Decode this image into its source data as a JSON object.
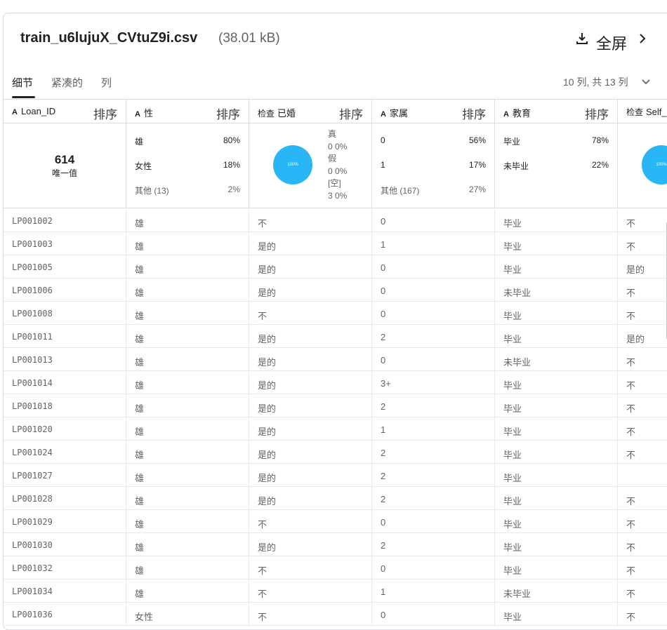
{
  "header": {
    "filename": "train_u6lujuX_CVtuZ9i.csv",
    "filesize": "(38.01 kB)",
    "fullscreen_label": "全屏"
  },
  "tabs": [
    {
      "label": "细节",
      "active": true
    },
    {
      "label": "紧凑的",
      "active": false
    },
    {
      "label": "列",
      "active": false
    }
  ],
  "column_count": "10 列, 共 13 列",
  "columns": [
    {
      "name": "Loan_ID",
      "type_icon": "A",
      "sort": "排序"
    },
    {
      "name": "性",
      "type_icon": "A",
      "sort": "排序"
    },
    {
      "name": "已婚",
      "type_icon": "检查",
      "sort": "排序"
    },
    {
      "name": "家属",
      "type_icon": "A",
      "sort": "排序"
    },
    {
      "name": "教育",
      "type_icon": "A",
      "sort": "排序"
    },
    {
      "name": "Self_",
      "type_icon": "检查",
      "sort": ""
    }
  ],
  "summary": {
    "loan_id": {
      "unique_count": "614",
      "unique_label": "唯一值"
    },
    "gender": [
      {
        "label": "雄",
        "pct": "80%"
      },
      {
        "label": "女性",
        "pct": "18%"
      },
      {
        "label": "其他 (13)",
        "pct": "2%"
      }
    ],
    "married": {
      "pie_label": "100%",
      "legend": [
        "真",
        "0  0%",
        "假",
        "0  0%",
        "[空]",
        "3  0%"
      ]
    },
    "dependents": [
      {
        "label": "0",
        "pct": "56%"
      },
      {
        "label": "1",
        "pct": "17%"
      },
      {
        "label": "其他 (167)",
        "pct": "27%"
      }
    ],
    "education": [
      {
        "label": "毕业",
        "pct": "78%"
      },
      {
        "label": "未毕业",
        "pct": "22%"
      }
    ],
    "self_employed": {
      "pie_label": "100%"
    }
  },
  "rows": [
    [
      "LP001002",
      "雄",
      "不",
      "0",
      "毕业",
      "不"
    ],
    [
      "LP001003",
      "雄",
      "是的",
      "1",
      "毕业",
      "不"
    ],
    [
      "LP001005",
      "雄",
      "是的",
      "0",
      "毕业",
      "是的"
    ],
    [
      "LP001006",
      "雄",
      "是的",
      "0",
      "未毕业",
      "不"
    ],
    [
      "LP001008",
      "雄",
      "不",
      "0",
      "毕业",
      "不"
    ],
    [
      "LP001011",
      "雄",
      "是的",
      "2",
      "毕业",
      "是的"
    ],
    [
      "LP001013",
      "雄",
      "是的",
      "0",
      "未毕业",
      "不"
    ],
    [
      "LP001014",
      "雄",
      "是的",
      "3+",
      "毕业",
      "不"
    ],
    [
      "LP001018",
      "雄",
      "是的",
      "2",
      "毕业",
      "不"
    ],
    [
      "LP001020",
      "雄",
      "是的",
      "1",
      "毕业",
      "不"
    ],
    [
      "LP001024",
      "雄",
      "是的",
      "2",
      "毕业",
      "不"
    ],
    [
      "LP001027",
      "雄",
      "是的",
      "2",
      "毕业",
      ""
    ],
    [
      "LP001028",
      "雄",
      "是的",
      "2",
      "毕业",
      "不"
    ],
    [
      "LP001029",
      "雄",
      "不",
      "0",
      "毕业",
      "不"
    ],
    [
      "LP001030",
      "雄",
      "是的",
      "2",
      "毕业",
      "不"
    ],
    [
      "LP001032",
      "雄",
      "不",
      "0",
      "毕业",
      "不"
    ],
    [
      "LP001034",
      "雄",
      "不",
      "1",
      "未毕业",
      "不"
    ],
    [
      "LP001036",
      "女性",
      "不",
      "0",
      "毕业",
      "不"
    ]
  ]
}
